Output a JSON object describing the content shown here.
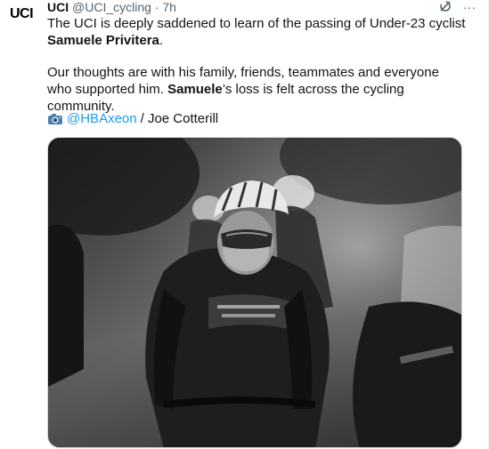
{
  "tweet": {
    "display_name": "UCI",
    "handle": "@UCI_cycling",
    "separator": "·",
    "time": "7h",
    "avatar_text": "UCI",
    "actions": [
      {
        "icon": "grok-icon"
      },
      {
        "icon": "more-icon",
        "label": "···"
      }
    ],
    "text": {
      "p1_a": "The UCI is deeply saddened to learn of the passing of Under-23 cyclist",
      "p1_b": "Samuele Privitera",
      "p1_c": ".",
      "p2_a": "Our thoughts are with his family, friends, teammates and everyone who supported him. ",
      "p2_b": "Samuele",
      "p2_c": "’s loss is felt across the cycling community."
    },
    "credit": {
      "icon": "camera-icon",
      "mention": "@HBAxeon",
      "rest": "/ Joe Cotterill"
    },
    "media": {
      "description_icon": "photo-cyclist"
    }
  },
  "colors": {
    "text": "#0f1419",
    "secondary": "#536471",
    "link": "#1d9bf0",
    "border": "#cfd9de"
  }
}
